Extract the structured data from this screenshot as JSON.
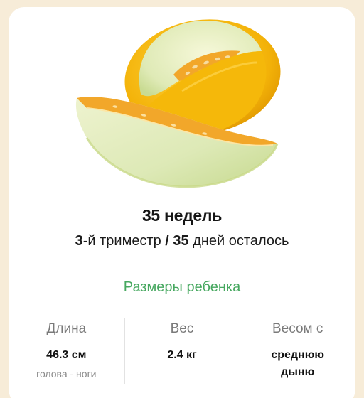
{
  "hero": {
    "image": "melon-illustration"
  },
  "week": {
    "title": "35 недель"
  },
  "subtitle": {
    "trimester_number": "3",
    "trimester_suffix": "-й триместр ",
    "separator": "/",
    "days_number": " 35",
    "days_suffix": " дней осталось"
  },
  "section": {
    "title": "Размеры ребенка"
  },
  "stats": [
    {
      "label": "Длина",
      "value": "46.3 см",
      "note": "голова - ноги"
    },
    {
      "label": "Вес",
      "value": "2.4 кг"
    },
    {
      "label": "Весом с",
      "value_line1": "среднюю",
      "value_line2": "дыню"
    }
  ],
  "colors": {
    "background": "#f7ecd8",
    "accent_green": "#47a860",
    "melon_rind": "#f3b208",
    "melon_flesh": "#e6efc4"
  }
}
